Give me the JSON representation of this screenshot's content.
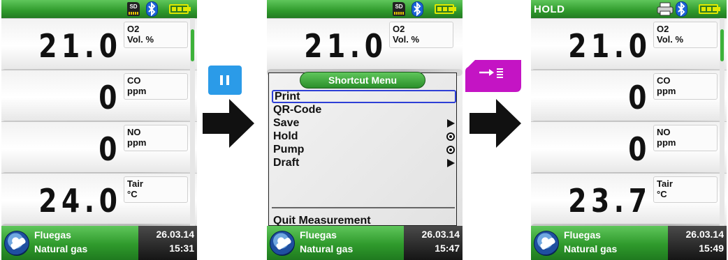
{
  "screens": [
    {
      "time": "15:31",
      "date": "26.03.14",
      "fuel_type": "Fluegas",
      "fuel_name": "Natural gas",
      "rows": [
        {
          "value": "21.0",
          "param": "O2",
          "unit": "Vol. %"
        },
        {
          "value": "0",
          "param": "CO",
          "unit": "ppm"
        },
        {
          "value": "0",
          "param": "NO",
          "unit": "ppm"
        },
        {
          "value": "24.0",
          "param": "Tair",
          "unit": "°C"
        }
      ]
    },
    {
      "time": "15:47",
      "date": "26.03.14",
      "fuel_type": "Fluegas",
      "fuel_name": "Natural gas",
      "rows": [
        {
          "value": "21.0",
          "param": "O2",
          "unit": "Vol. %"
        }
      ],
      "menu": {
        "title": "Shortcut Menu",
        "items": [
          {
            "label": "Print",
            "indicator": "none",
            "selected": true
          },
          {
            "label": "QR-Code",
            "indicator": "none"
          },
          {
            "label": "Save",
            "indicator": "arrow-right-icon"
          },
          {
            "label": "Hold",
            "indicator": "radio-icon"
          },
          {
            "label": "Pump",
            "indicator": "radio-icon"
          },
          {
            "label": "Draft",
            "indicator": "arrow-right-icon"
          }
        ],
        "quit": "Quit Measurement"
      }
    },
    {
      "status": "HOLD",
      "time": "15:49",
      "date": "26.03.14",
      "fuel_type": "Fluegas",
      "fuel_name": "Natural gas",
      "rows": [
        {
          "value": "21.0",
          "param": "O2",
          "unit": "Vol. %"
        },
        {
          "value": "0",
          "param": "CO",
          "unit": "ppm"
        },
        {
          "value": "0",
          "param": "NO",
          "unit": "ppm"
        },
        {
          "value": "23.7",
          "param": "Tair",
          "unit": "°C"
        }
      ]
    }
  ],
  "icons": {
    "sd": "SD",
    "bluetooth": "bluetooth-icon",
    "battery": "battery-icon",
    "printer": "printer-icon",
    "pause": "pause-icon",
    "print_key": "print-key-icon",
    "arrow": "arrow-right-icon"
  },
  "colors": {
    "bar_green": "#2f9a2c",
    "pause_key": "#2b9be8",
    "print_key": "#c414c4",
    "menu_selection": "#2d3fd6"
  }
}
